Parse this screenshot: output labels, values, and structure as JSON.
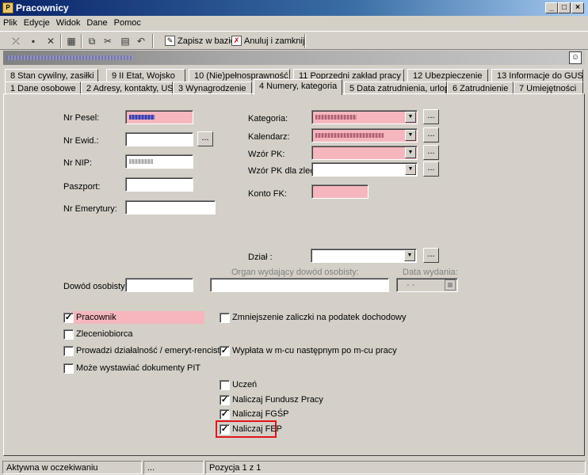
{
  "window": {
    "title": "Pracownicy"
  },
  "menu": [
    "Plik",
    "Edycje",
    "Widok",
    "Dane",
    "Pomoc"
  ],
  "toolbar": {
    "save_label": "Zapisz w bazie",
    "cancel_label": "Anuluj i zamknij"
  },
  "tabs_row1": [
    "8 Stan cywilny, zasiłki",
    "9 II Etat, Wojsko",
    "10 (Nie)pełnosprawność",
    "11 Poprzedni zakład pracy",
    "12 Ubezpieczenie",
    "13 Informacje do GUS"
  ],
  "tabs_row2": [
    "1 Dane osobowe",
    "2 Adresy, kontakty, US",
    "3 Wynagrodzenie",
    "4 Numery, kategoria",
    "5 Data zatrudnienia, urlop",
    "6 Zatrudnienie",
    "7 Umiejętności"
  ],
  "form": {
    "pesel_label": "Nr Pesel:",
    "ewid_label": "Nr Ewid.:",
    "nip_label": "Nr NIP:",
    "paszport_label": "Paszport:",
    "emerytury_label": "Nr Emerytury:",
    "kategoria_label": "Kategoria:",
    "kalendarz_label": "Kalendarz:",
    "wzor_pk_label": "Wzór PK:",
    "wzor_pk_zlec_label": "Wzór PK dla zlec.:",
    "konto_fk_label": "Konto FK:",
    "dzial_label": "Dział :",
    "dowod_label": "Dowód osobisty:",
    "organ_label": "Organ wydający dowód osobisty:",
    "data_wydania_label": "Data wydania:",
    "data_wydania_value": "- -",
    "dots": "..."
  },
  "checkboxes_left": [
    {
      "label": "Pracownik",
      "checked": true
    },
    {
      "label": "Zleceniobiorca",
      "checked": false
    },
    {
      "label": "Prowadzi działalność / emeryt-rencista",
      "checked": false
    },
    {
      "label": "Może wystawiać dokumenty PIT",
      "checked": false
    }
  ],
  "checkboxes_right": [
    {
      "label": "Zmniejszenie zaliczki na podatek dochodowy",
      "checked": false
    },
    {
      "label": "Wypłata w m-cu następnym po m-cu pracy",
      "checked": true
    },
    {
      "label": "Uczeń",
      "checked": false
    },
    {
      "label": "Naliczaj Fundusz Pracy",
      "checked": true
    },
    {
      "label": "Naliczaj FGŚP",
      "checked": true
    },
    {
      "label": "Naliczaj FEP",
      "checked": true
    }
  ],
  "status": {
    "left": "Aktywna w oczekiwaniu",
    "middle": "...",
    "right": "Pozycja 1 z 1"
  },
  "colors": {
    "required_field": "#f5b6bd",
    "highlight_border": "#e0141c",
    "titlebar": "#0a246a"
  }
}
